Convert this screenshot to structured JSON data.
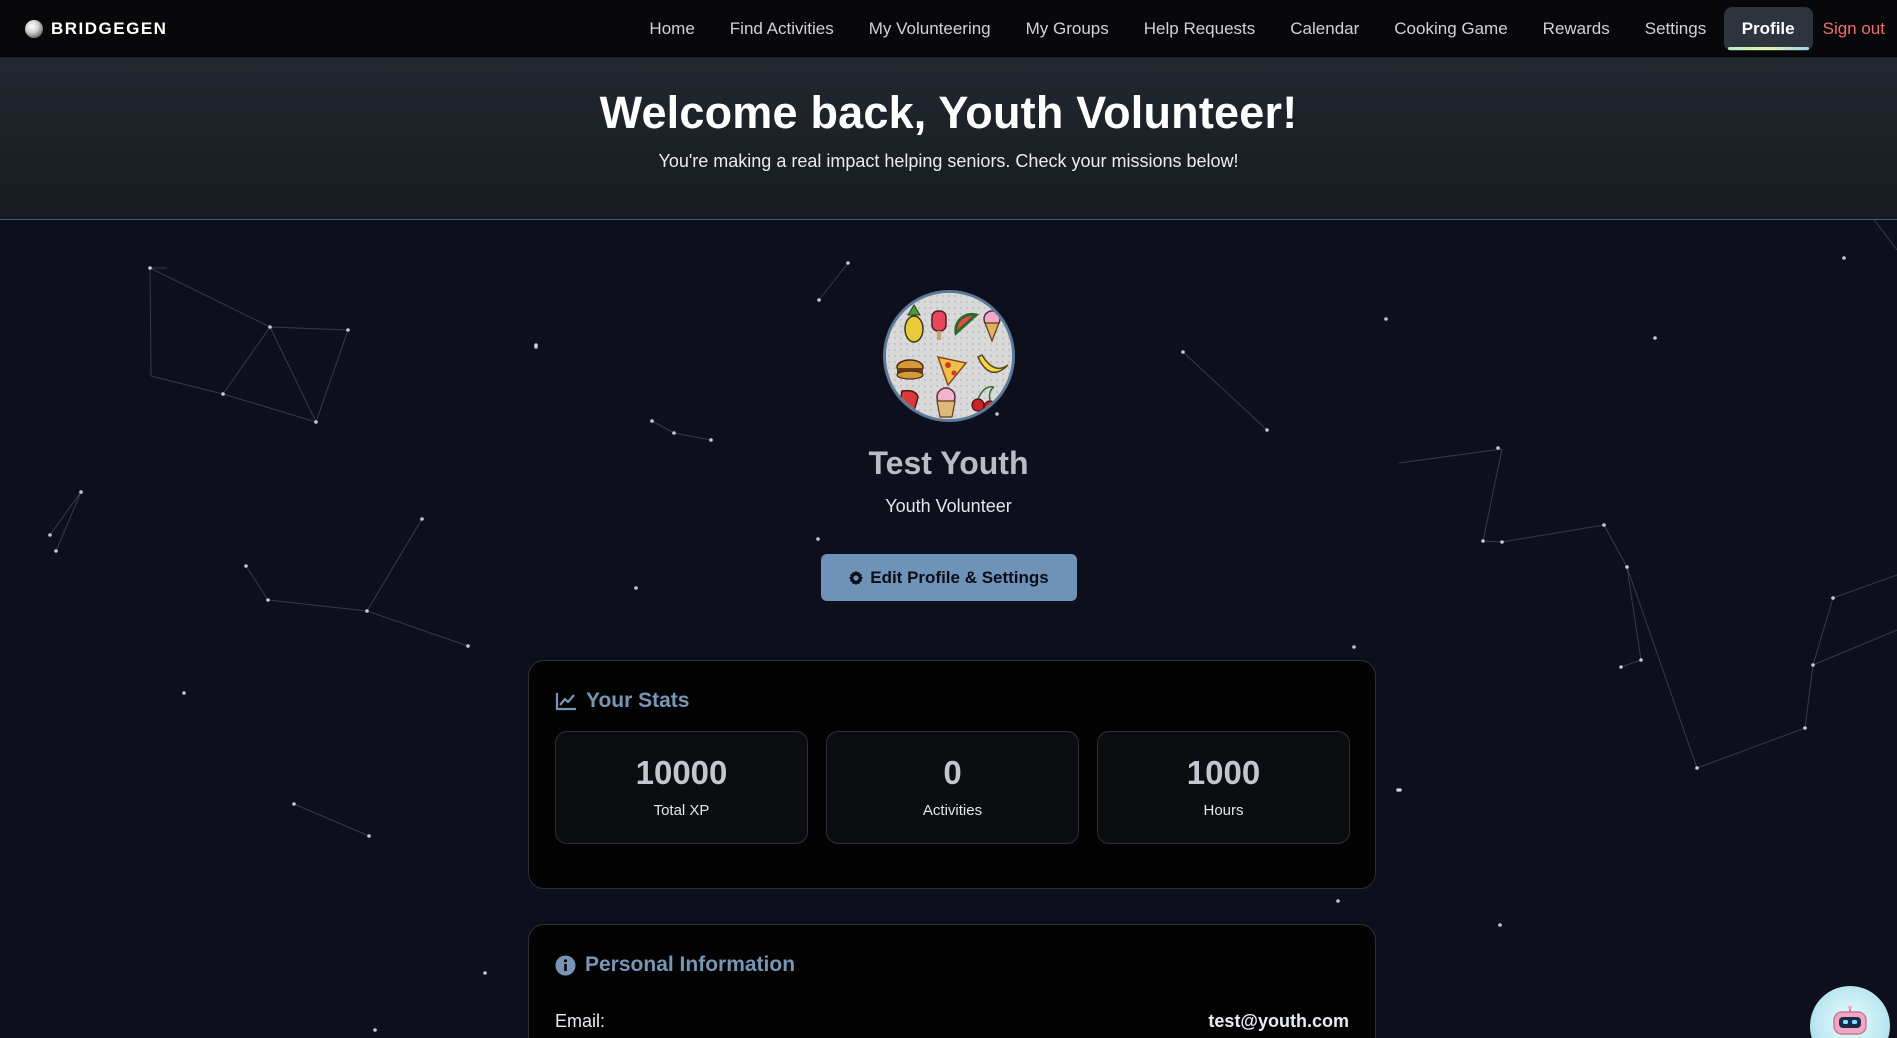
{
  "brand": {
    "name": "BRIDGEGEN"
  },
  "nav": {
    "items": [
      {
        "label": "Home"
      },
      {
        "label": "Find Activities"
      },
      {
        "label": "My Volunteering"
      },
      {
        "label": "My Groups"
      },
      {
        "label": "Help Requests"
      },
      {
        "label": "Calendar"
      },
      {
        "label": "Cooking Game"
      },
      {
        "label": "Rewards"
      },
      {
        "label": "Settings"
      }
    ],
    "active": {
      "label": "Profile"
    },
    "signout": {
      "label": "Sign out"
    }
  },
  "hero": {
    "title": "Welcome back, Youth Volunteer!",
    "subtitle": "You're making a real impact helping seniors. Check your missions below!"
  },
  "profile": {
    "name": "Test Youth",
    "role": "Youth Volunteer",
    "avatar_icon": "food-pattern-avatar",
    "edit_button": "Edit Profile & Settings"
  },
  "stats": {
    "title": "Your Stats",
    "items": [
      {
        "value": "10000",
        "label": "Total XP"
      },
      {
        "value": "0",
        "label": "Activities"
      },
      {
        "value": "1000",
        "label": "Hours"
      }
    ]
  },
  "personal_info": {
    "title": "Personal Information",
    "email_label": "Email:",
    "email_value": "test@youth.com"
  },
  "colors": {
    "background": "#0e0f1d",
    "navbar": "#08080a",
    "accent": "#7895b6",
    "button": "#6f93b8",
    "signout": "#f06c6c"
  }
}
